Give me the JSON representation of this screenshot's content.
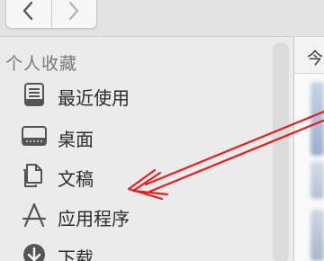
{
  "toolbar": {
    "back_icon": "chevron-left-icon",
    "forward_icon": "chevron-right-icon"
  },
  "sidebar": {
    "section_title": "个人收藏",
    "items": [
      {
        "label": "最近使用",
        "icon": "recents-icon"
      },
      {
        "label": "桌面",
        "icon": "desktop-icon"
      },
      {
        "label": "文稿",
        "icon": "documents-icon"
      },
      {
        "label": "应用程序",
        "icon": "applications-icon"
      },
      {
        "label": "下载",
        "icon": "downloads-icon"
      }
    ]
  },
  "content": {
    "header_text": "今"
  },
  "annotation": {
    "color": "#e31d1d",
    "icon": "red-arrow-annotation"
  },
  "colors": {
    "sidebar_bg": "#ebebeb",
    "section_text": "#7a7a7a",
    "item_text": "#2b2b2b"
  }
}
